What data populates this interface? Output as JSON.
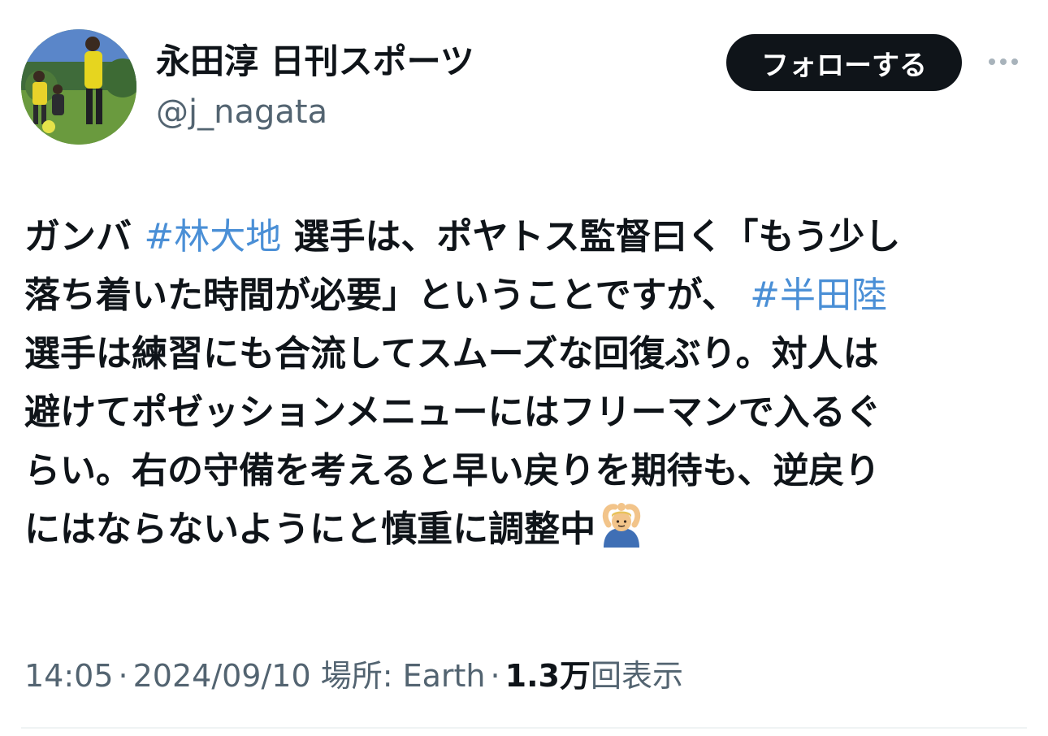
{
  "author": {
    "display_name": "永田淳 日刊スポーツ",
    "handle": "@j_nagata"
  },
  "actions": {
    "follow_label": "フォローする",
    "more_icon": "more-dots-icon"
  },
  "tweet": {
    "lines": [
      [
        {
          "text": "ガンバ ",
          "type": "text"
        },
        {
          "text": "#林大地",
          "type": "hashtag"
        },
        {
          "text": " 選手は、ポヤトス監督曰く「もう少し",
          "type": "text"
        }
      ],
      [
        {
          "text": "落ち着いた時間が必要」ということですが、 ",
          "type": "text"
        },
        {
          "text": "#半田陸",
          "type": "hashtag"
        }
      ],
      [
        {
          "text": "選手は練習にも合流してスムーズな回復ぶり。対人は",
          "type": "text"
        }
      ],
      [
        {
          "text": "避けてポゼッションメニューにはフリーマンで入るぐ",
          "type": "text"
        }
      ],
      [
        {
          "text": "らい。右の守備を考えると早い戻りを期待も、逆戻り",
          "type": "text"
        }
      ],
      [
        {
          "text": "にはならないようにと慎重に調整中",
          "type": "text"
        }
      ]
    ],
    "emoji": "person-gesturing-ok-icon"
  },
  "meta": {
    "time": "14:05",
    "sep1": "·",
    "date": "2024/09/10",
    "location": "場所: Earth",
    "sep2": "·",
    "views_count": "1.3万",
    "views_label": "回表示"
  },
  "colors": {
    "hashtag": "#4a8fd6",
    "text": "#0f1419",
    "secondary": "#536471",
    "follow_bg": "#0f1419"
  }
}
